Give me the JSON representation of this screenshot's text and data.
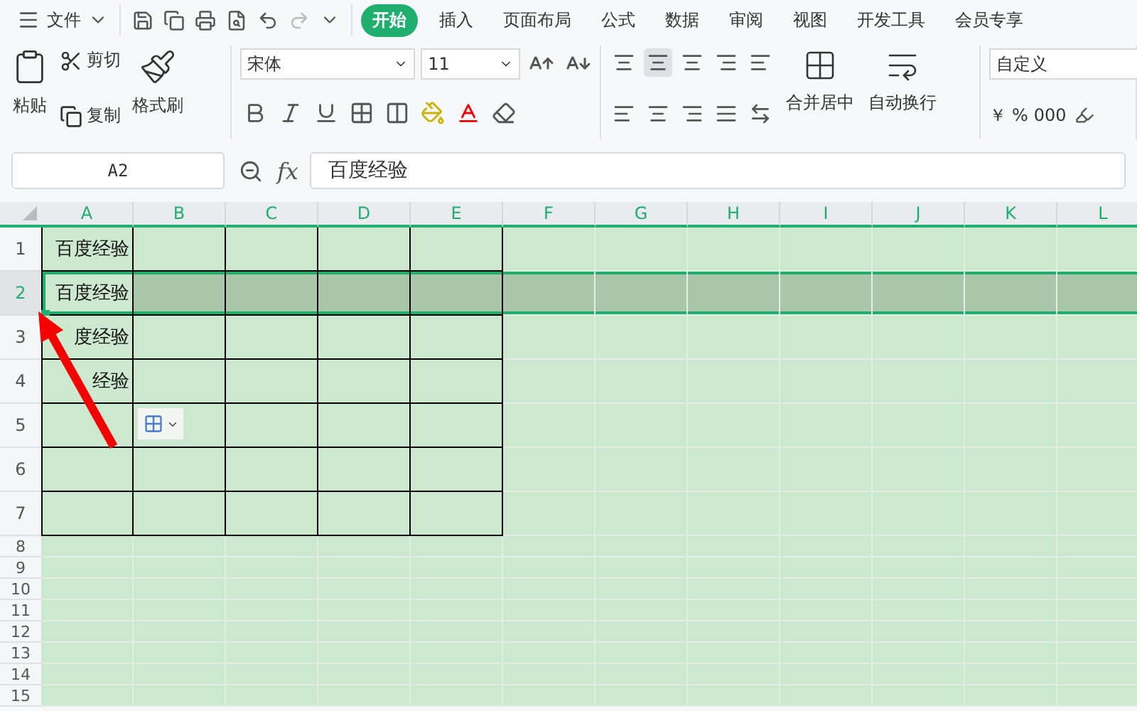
{
  "menu": {
    "file": "文件",
    "tabs": [
      {
        "label": "开始",
        "selected": true
      },
      {
        "label": "插入",
        "selected": false
      },
      {
        "label": "页面布局",
        "selected": false
      },
      {
        "label": "公式",
        "selected": false
      },
      {
        "label": "数据",
        "selected": false
      },
      {
        "label": "审阅",
        "selected": false
      },
      {
        "label": "视图",
        "selected": false
      },
      {
        "label": "开发工具",
        "selected": false
      },
      {
        "label": "会员专享",
        "selected": false
      }
    ]
  },
  "ribbon": {
    "paste": "粘贴",
    "cut": "剪切",
    "copy": "复制",
    "format_painter": "格式刷",
    "font": "宋体",
    "font_size": "11",
    "merge": "合并居中",
    "wrap": "自动换行",
    "number_format": "自定义",
    "currency": "￥",
    "percent": "%",
    "thousands": "000",
    "align_buttons": [
      {
        "kind": "top",
        "selected": false
      },
      {
        "kind": "middle",
        "selected": true
      },
      {
        "kind": "bottom",
        "selected": false
      },
      {
        "kind": "outdent",
        "selected": false
      },
      {
        "kind": "indent",
        "selected": false
      }
    ]
  },
  "formula_bar": {
    "cell": "A2",
    "fx": "fx",
    "value": "百度经验"
  },
  "sheet": {
    "columns": [
      "A",
      "B",
      "C",
      "D",
      "E",
      "F",
      "G",
      "H",
      "I",
      "J",
      "K",
      "L"
    ],
    "rows": [
      {
        "label": "1",
        "selected": false,
        "cells": [
          "百度经验"
        ]
      },
      {
        "label": "2",
        "selected": true,
        "cells": [
          "百度经验"
        ]
      },
      {
        "label": "3",
        "selected": false,
        "cells": [
          "度经验"
        ]
      },
      {
        "label": "4",
        "selected": false,
        "cells": [
          "经验"
        ]
      },
      {
        "label": "5",
        "selected": false,
        "cells": []
      },
      {
        "label": "6",
        "selected": false,
        "cells": []
      },
      {
        "label": "7",
        "selected": false,
        "cells": []
      },
      {
        "label": "8",
        "selected": false,
        "cells": []
      },
      {
        "label": "9",
        "selected": false,
        "cells": []
      },
      {
        "label": "10",
        "selected": false,
        "cells": []
      },
      {
        "label": "11",
        "selected": false,
        "cells": []
      },
      {
        "label": "12",
        "selected": false,
        "cells": []
      },
      {
        "label": "13",
        "selected": false,
        "cells": []
      },
      {
        "label": "14",
        "selected": false,
        "cells": []
      },
      {
        "label": "15",
        "selected": false,
        "cells": []
      }
    ]
  }
}
